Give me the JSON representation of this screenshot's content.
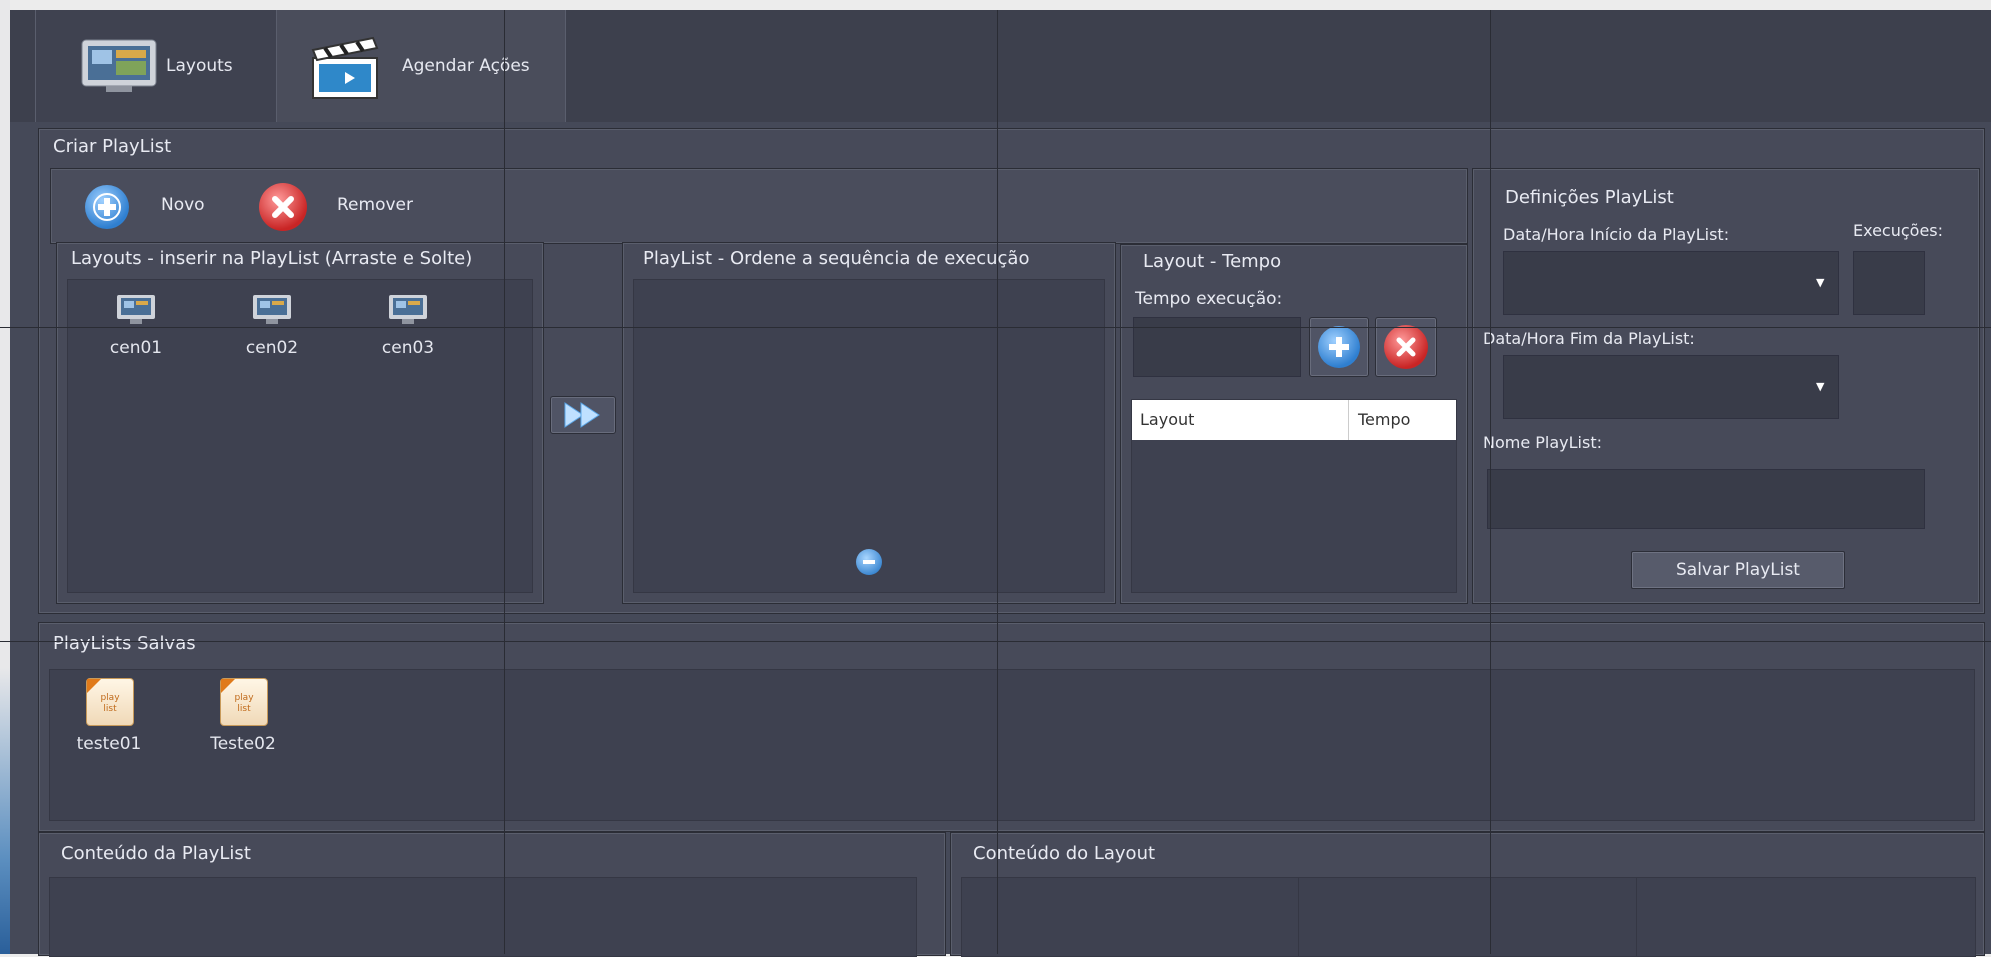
{
  "tabs": [
    {
      "label": "Layouts",
      "icon": "monitor-icon"
    },
    {
      "label": "Agendar Ações",
      "icon": "clapperboard-icon"
    }
  ],
  "criar": {
    "title": "Criar PlayList",
    "novo_label": "Novo",
    "remover_label": "Remover"
  },
  "layouts_panel": {
    "title": "Layouts - inserir na PlayList (Arraste e Solte)",
    "items": [
      "cen01",
      "cen02",
      "cen03"
    ]
  },
  "playlist_panel": {
    "title": "PlayList - Ordene a sequência de execução"
  },
  "layout_tempo": {
    "title": "Layout - Tempo",
    "tempo_label": "Tempo execução:",
    "columns": [
      "Layout",
      "Tempo"
    ]
  },
  "definicoes": {
    "title": "Definições PlayList",
    "inicio_label": "Data/Hora Início da PlayList:",
    "execucoes_label": "Execuções:",
    "fim_label": "Data/Hora Fim da PlayList:",
    "nome_label": "Nome PlayList:",
    "save_label": "Salvar PlayList"
  },
  "salvas": {
    "title": "PlayLists Salvas",
    "items": [
      "teste01",
      "Teste02"
    ],
    "icon_text": "play list"
  },
  "conteudo_playlist": {
    "title": "Conteúdo da PlayList"
  },
  "conteudo_layout": {
    "title": "Conteúdo do Layout"
  },
  "colors": {
    "background": "#454958",
    "add_blue": "#3e8fd9",
    "remove_red": "#d93a3a"
  }
}
